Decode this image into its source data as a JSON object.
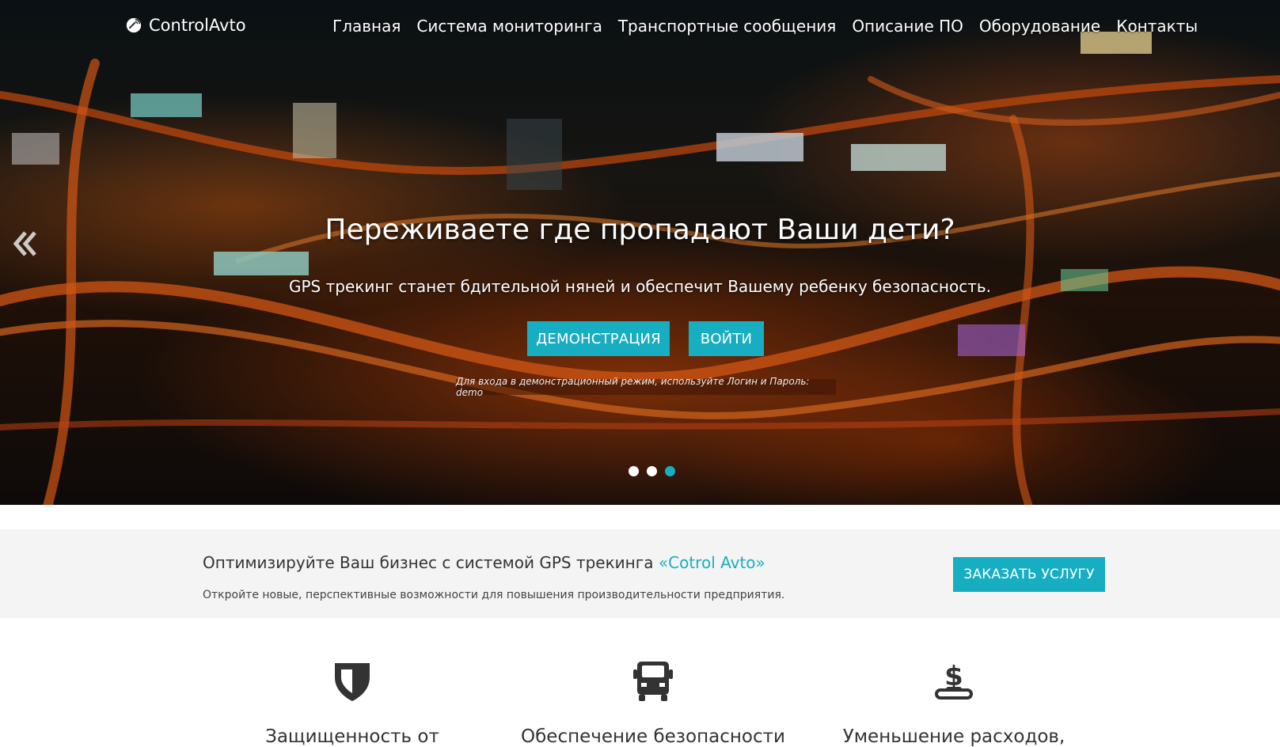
{
  "brand": {
    "name": "ControlAvto",
    "icon": "satellite-dish-icon"
  },
  "nav": {
    "items": [
      {
        "label": "Главная"
      },
      {
        "label": "Система мониторинга"
      },
      {
        "label": "Транспортные сообщения"
      },
      {
        "label": "Описание ПО"
      },
      {
        "label": "Оборудование"
      },
      {
        "label": "Контакты"
      }
    ]
  },
  "hero": {
    "title": "Переживаете где пропадают Ваши дети?",
    "subtitle": "GPS трекинг станет бдительной няней и обеспечит Вашему ребенку безопасность.",
    "demo_button": "ДЕМОНСТРАЦИЯ",
    "login_button": "ВОЙТИ",
    "note": "Для входа в демонстрационный режим, используйте Логин и Пароль: demo",
    "prev_icon": "double-chevron-left-icon",
    "slides_count": 3,
    "active_slide": 3
  },
  "promo": {
    "title_prefix": "Оптимизируйте Ваш бизнес с системой GPS трекинга ",
    "title_accent": "«Cotrol Avto»",
    "text": "Откройте новые, перспективные возможности для повышения производительности предприятия.",
    "order_button": "ЗАКАЗАТЬ УСЛУГУ"
  },
  "features": [
    {
      "icon": "shield-icon",
      "title": "Защищенность от"
    },
    {
      "icon": "truck-icon",
      "title": "Обеспечение безопасности"
    },
    {
      "icon": "dollar-hand-icon",
      "title": "Уменьшение расходов,"
    }
  ],
  "colors": {
    "accent": "#18aec2",
    "promo_bg": "#f4f4f4",
    "icon_dark": "#333333"
  }
}
